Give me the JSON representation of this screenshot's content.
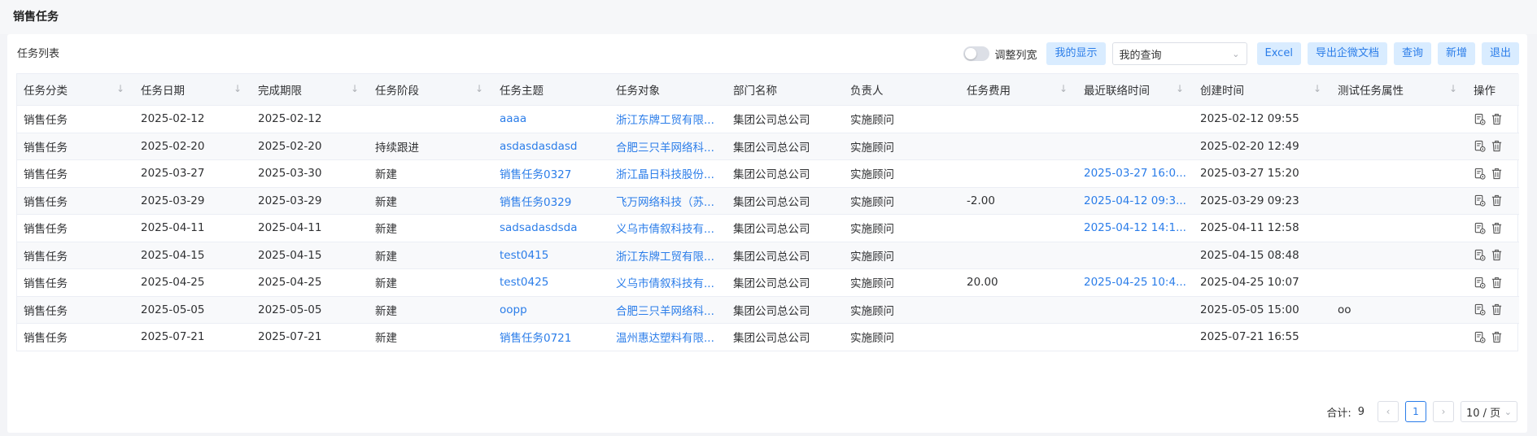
{
  "page_title": "销售任务",
  "panel_title": "任务列表",
  "toolbar": {
    "switch_label": "调整列宽",
    "my_display": "我的显示",
    "query_select_value": "我的查询",
    "excel": "Excel",
    "export_doc": "导出企微文档",
    "query": "查询",
    "add": "新增",
    "exit": "退出"
  },
  "columns": [
    "任务分类",
    "任务日期",
    "完成期限",
    "任务阶段",
    "任务主题",
    "任务对象",
    "部门名称",
    "负责人",
    "任务费用",
    "最近联络时间",
    "创建时间",
    "测试任务属性",
    "操作"
  ],
  "rows": [
    {
      "cat": "销售任务",
      "date": "2025-02-12",
      "deadline": "2025-02-12",
      "stage": "",
      "subject": "aaaa",
      "target": "浙江东牌工贸有限...",
      "dept": "集团公司总公司",
      "owner": "实施顾问",
      "fee": "",
      "last_contact": "",
      "created": "2025-02-12 09:55",
      "attr": ""
    },
    {
      "cat": "销售任务",
      "date": "2025-02-20",
      "deadline": "2025-02-20",
      "stage": "持续跟进",
      "subject": "asdasdasdasd",
      "target": "合肥三只羊网络科...",
      "dept": "集团公司总公司",
      "owner": "实施顾问",
      "fee": "",
      "last_contact": "",
      "created": "2025-02-20 12:49",
      "attr": ""
    },
    {
      "cat": "销售任务",
      "date": "2025-03-27",
      "deadline": "2025-03-30",
      "stage": "新建",
      "subject": "销售任务0327",
      "target": "浙江晶日科技股份...",
      "dept": "集团公司总公司",
      "owner": "实施顾问",
      "fee": "",
      "last_contact": "2025-03-27 16:0...",
      "created": "2025-03-27 15:20",
      "attr": ""
    },
    {
      "cat": "销售任务",
      "date": "2025-03-29",
      "deadline": "2025-03-29",
      "stage": "新建",
      "subject": "销售任务0329",
      "target": "飞万网络科技（苏...",
      "dept": "集团公司总公司",
      "owner": "实施顾问",
      "fee": "-2.00",
      "last_contact": "2025-04-12 09:3...",
      "created": "2025-03-29 09:23",
      "attr": ""
    },
    {
      "cat": "销售任务",
      "date": "2025-04-11",
      "deadline": "2025-04-11",
      "stage": "新建",
      "subject": "sadsadasdsda",
      "target": "义乌市倩叙科技有...",
      "dept": "集团公司总公司",
      "owner": "实施顾问",
      "fee": "",
      "last_contact": "2025-04-12 14:1...",
      "created": "2025-04-11 12:58",
      "attr": ""
    },
    {
      "cat": "销售任务",
      "date": "2025-04-15",
      "deadline": "2025-04-15",
      "stage": "新建",
      "subject": "test0415",
      "target": "浙江东牌工贸有限...",
      "dept": "集团公司总公司",
      "owner": "实施顾问",
      "fee": "",
      "last_contact": "",
      "created": "2025-04-15 08:48",
      "attr": ""
    },
    {
      "cat": "销售任务",
      "date": "2025-04-25",
      "deadline": "2025-04-25",
      "stage": "新建",
      "subject": "test0425",
      "target": "义乌市倩叙科技有...",
      "dept": "集团公司总公司",
      "owner": "实施顾问",
      "fee": "20.00",
      "last_contact": "2025-04-25 10:4...",
      "created": "2025-04-25 10:07",
      "attr": ""
    },
    {
      "cat": "销售任务",
      "date": "2025-05-05",
      "deadline": "2025-05-05",
      "stage": "新建",
      "subject": "oopp",
      "target": "合肥三只羊网络科...",
      "dept": "集团公司总公司",
      "owner": "实施顾问",
      "fee": "",
      "last_contact": "",
      "created": "2025-05-05 15:00",
      "attr": "oo"
    },
    {
      "cat": "销售任务",
      "date": "2025-07-21",
      "deadline": "2025-07-21",
      "stage": "新建",
      "subject": "销售任务0721",
      "target": "温州惠达塑料有限...",
      "dept": "集团公司总公司",
      "owner": "实施顾问",
      "fee": "",
      "last_contact": "",
      "created": "2025-07-21 16:55",
      "attr": ""
    }
  ],
  "pagination": {
    "total_label": "合计:",
    "total": "9",
    "current_page": "1",
    "page_size": "10 / 页"
  },
  "icons": {
    "edit": "edit-doc-icon",
    "delete": "trash-icon",
    "sort": "sort-arrow-icon"
  },
  "colors": {
    "accent": "#2b7de9",
    "button_bg": "#d9ecff"
  }
}
